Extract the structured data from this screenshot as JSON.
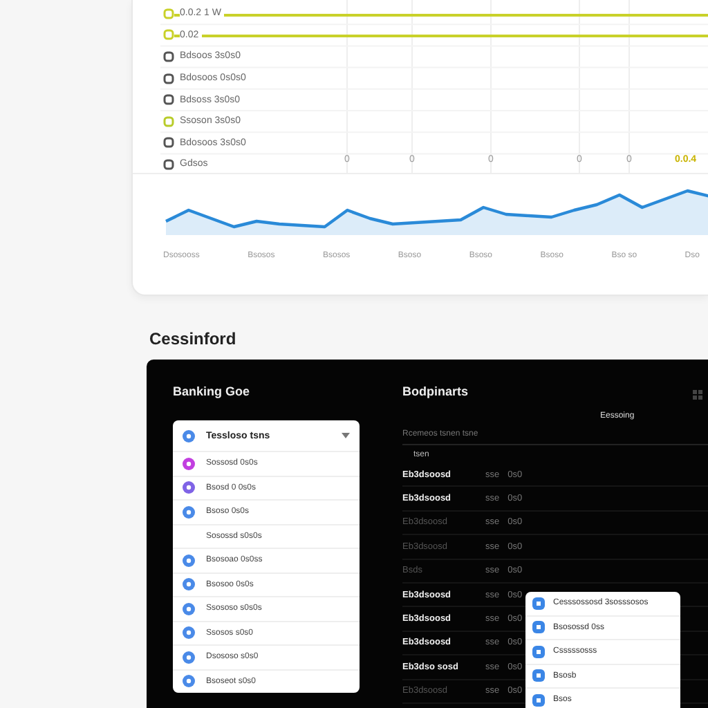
{
  "top_chart": {
    "legend": [
      {
        "label": "0.0.2 1 W",
        "color": "#c9d12a",
        "highlighted": true
      },
      {
        "label": "0.02",
        "color": "#c9d12a",
        "highlighted": true
      },
      {
        "label": "Bdsoos 3s0s0",
        "color": "#555555",
        "highlighted": false
      },
      {
        "label": "Bdosoos 0s0s0",
        "color": "#555555",
        "highlighted": false
      },
      {
        "label": "Bdsoss 3s0s0",
        "color": "#555555",
        "highlighted": false
      },
      {
        "label": "Ssoson 3s0s0",
        "color": "#b8cc2a",
        "highlighted": false
      },
      {
        "label": "Bdosoos 3s0s0",
        "color": "#555555",
        "highlighted": false
      },
      {
        "label": "Gdsos",
        "color": "#555555",
        "highlighted": false
      }
    ],
    "tick_labels": [
      "0",
      "0",
      "0",
      "0",
      "0"
    ],
    "tick_highlight": "0.0.4",
    "x_labels": [
      "Dsosooss",
      "Bsosos",
      "Bsosos",
      "Bsoso",
      "Bsoso",
      "Bsoso",
      "Bso so",
      "Dso"
    ]
  },
  "heading": "Cessinford",
  "left_panel": {
    "title": "Banking Goe",
    "dropdown": {
      "label": "Tessloso tsns",
      "color": "#4a8ae8"
    },
    "items": [
      {
        "label": "Sossosd 0s0s",
        "color": "#c23fe0"
      },
      {
        "label": "Bsosd 0 0s0s",
        "color": "#7f63e6"
      },
      {
        "label": "Bsoso 0s0s",
        "color": "#4a8ae8"
      },
      {
        "label": "Sosossd s0s0s"
      },
      {
        "label": "Bsosoao 0s0ss",
        "color": "#4a8ae8"
      },
      {
        "label": "Bsosoo 0s0s",
        "color": "#4a8ae8"
      },
      {
        "label": "Ssososo s0s0s",
        "color": "#4a8ae8"
      },
      {
        "label": "Ssosos s0s0",
        "color": "#4a8ae8"
      },
      {
        "label": "Dsososo s0s0",
        "color": "#4a8ae8"
      },
      {
        "label": "Bsoseot s0s0",
        "color": "#4a8ae8"
      }
    ]
  },
  "right_panel": {
    "title": "Bodpinarts",
    "subtitle": "Eessoing",
    "header": "Rcemeos tsnen tsne",
    "column_1": "tsen",
    "rows": [
      {
        "name": "Eb3dsoosd",
        "column_2": "sse",
        "column_3": "0s0",
        "dimmed": false
      },
      {
        "name": "Eb3dsoosd",
        "column_2": "sse",
        "column_3": "0s0",
        "dimmed": false
      },
      {
        "name": "Eb3dsoosd",
        "column_2": "sse",
        "column_3": "0s0",
        "dimmed": true
      },
      {
        "name": "Eb3dsoosd",
        "column_2": "sse",
        "column_3": "0s0",
        "dimmed": true
      },
      {
        "name": "Bsds",
        "column_2": "sse",
        "column_3": "0s0",
        "dimmed": true
      },
      {
        "name": "Eb3dsoosd",
        "column_2": "sse",
        "column_3": "0s0",
        "dimmed": false
      },
      {
        "name": "Eb3dsoosd",
        "column_2": "sse",
        "column_3": "0s0",
        "dimmed": false
      },
      {
        "name": "Eb3dsoosd",
        "column_2": "sse",
        "column_3": "0s0",
        "dimmed": false
      },
      {
        "name": "Eb3dso sosd",
        "column_2": "sse",
        "column_3": "0s0",
        "dimmed": false
      },
      {
        "name": "Eb3dsoosd",
        "column_2": "sse",
        "column_3": "0s0",
        "dimmed": true
      }
    ],
    "popup": [
      {
        "label": "Cesssossosd 3sosssosos"
      },
      {
        "label": "Bsosossd 0ss"
      },
      {
        "label": "Csssssosss"
      },
      {
        "label": "Bsosb"
      },
      {
        "label": "Bsos"
      }
    ]
  }
}
